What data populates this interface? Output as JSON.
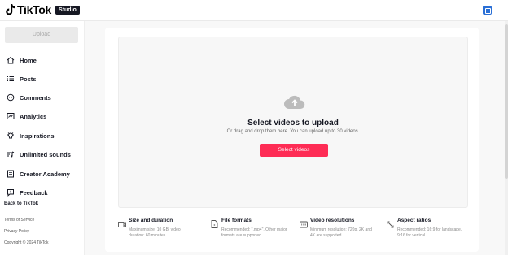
{
  "header": {
    "logo_text": "TikTok",
    "studio_badge": "Studio",
    "profile_icon": "profile-square-icon"
  },
  "sidebar": {
    "upload_label": "Upload",
    "items": [
      {
        "label": "Home",
        "icon": "home-icon"
      },
      {
        "label": "Posts",
        "icon": "list-icon"
      },
      {
        "label": "Comments",
        "icon": "comment-icon"
      },
      {
        "label": "Analytics",
        "icon": "chart-icon"
      },
      {
        "label": "Inspirations",
        "icon": "bulb-icon"
      },
      {
        "label": "Unlimited sounds",
        "icon": "music-icon"
      },
      {
        "label": "Creator Academy",
        "icon": "book-icon"
      },
      {
        "label": "Feedback",
        "icon": "feedback-icon"
      }
    ],
    "back_link": "Back to TikTok",
    "footer": [
      "Terms of Service",
      "Privacy Policy",
      "Copyright © 2024 TikTok"
    ]
  },
  "upload": {
    "title": "Select videos to upload",
    "subtitle": "Or drag and drop them here. You can upload up to 30 videos.",
    "button": "Select videos"
  },
  "info": [
    {
      "title": "Size and duration",
      "desc": "Maximum size: 10 GB, video duration: 60 minutes.",
      "icon": "video-icon"
    },
    {
      "title": "File formats",
      "desc": "Recommended: \".mp4\". Other major formats are supported.",
      "icon": "file-icon"
    },
    {
      "title": "Video resolutions",
      "desc": "Minimum resolution: 720p. 2K and 4K are supported.",
      "icon": "hd-icon"
    },
    {
      "title": "Aspect ratios",
      "desc": "Recommended: 16:9 for landscape, 9:16 for vertical.",
      "icon": "aspect-ratio-icon"
    }
  ],
  "colors": {
    "accent": "#fe2c55",
    "text": "#161823",
    "muted": "#8a8a8a"
  }
}
